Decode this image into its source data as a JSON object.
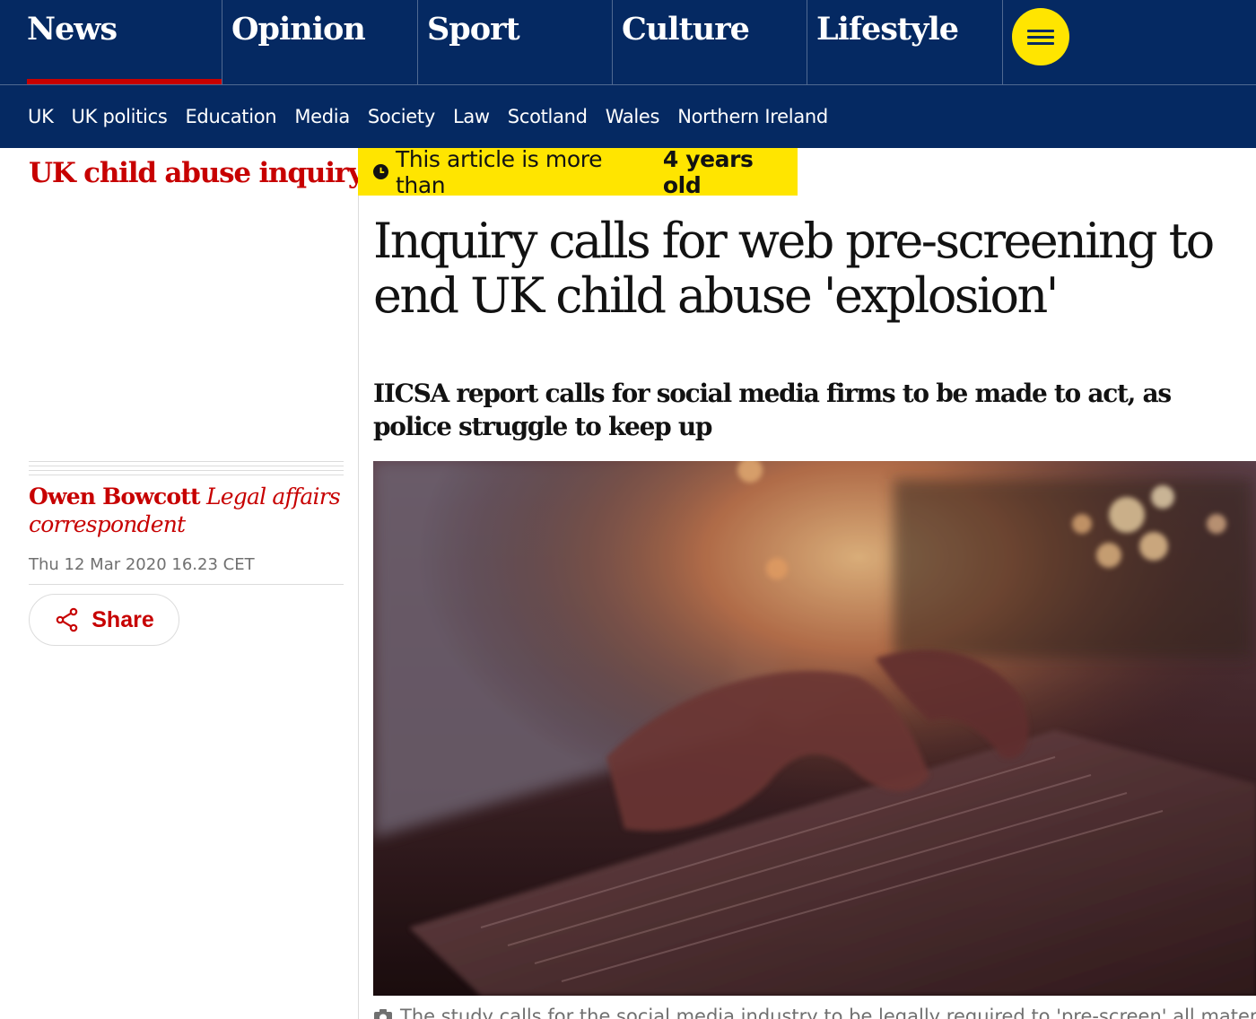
{
  "nav": {
    "pillars": [
      {
        "label": "News",
        "active": true
      },
      {
        "label": "Opinion"
      },
      {
        "label": "Sport"
      },
      {
        "label": "Culture"
      },
      {
        "label": "Lifestyle"
      }
    ],
    "menu_icon": "hamburger-icon",
    "subnav": [
      "UK",
      "UK politics",
      "Education",
      "Media",
      "Society",
      "Law",
      "Scotland",
      "Wales",
      "Northern Ireland"
    ]
  },
  "colors": {
    "brand_blue": "#052962",
    "accent_red": "#c70000",
    "highlight_yellow": "#ffe500"
  },
  "article": {
    "series": "UK child abuse inquiry",
    "age_warning": {
      "prefix": "This article is more than ",
      "age": "4 years old",
      "icon": "clock-icon"
    },
    "headline": "Inquiry calls for web pre-screening to end UK child abuse 'explosion'",
    "standfirst": "IICSA report calls for social media firms to be made to act, as police struggle to keep up",
    "byline": {
      "name": "Owen Bowcott",
      "role": "Legal affairs correspondent"
    },
    "dateline": "Thu 12 Mar 2020 16.23 CET",
    "share_label": "Share",
    "share_icon": "share-icon",
    "image_caption": "The study calls for the social media industry to be legally required to 'pre-screen' all material",
    "caption_icon": "camera-icon"
  }
}
